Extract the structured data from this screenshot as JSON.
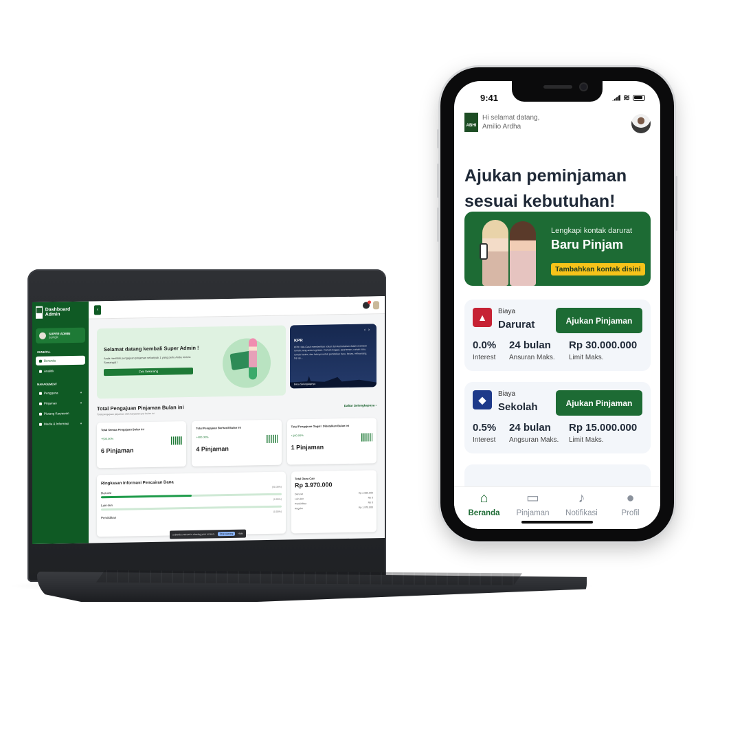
{
  "laptop": {
    "sidebar": {
      "brand_title": "Dashboard Admin",
      "user_name": "SUPER ADMIN",
      "user_role": "SUPER",
      "section_general": "GENERAL",
      "section_management": "MANAGEMENT",
      "items": [
        {
          "label": "Beranda",
          "icon": "home-icon",
          "active": true
        },
        {
          "label": "Analitik",
          "icon": "chart-icon",
          "active": false
        },
        {
          "label": "Pengguna",
          "icon": "user-icon",
          "active": false
        },
        {
          "label": "Pinjaman",
          "icon": "card-icon",
          "active": false
        },
        {
          "label": "Piutang Karyawan",
          "icon": "wallet-icon",
          "active": false
        },
        {
          "label": "Media & Informasi",
          "icon": "media-icon",
          "active": false
        }
      ]
    },
    "welcome": {
      "title": "Selamat datang kembali Super Admin !",
      "text": "Anda memiliki pengajuan pinjaman sebanyak 1 yang perlu Anda review. Semangat !",
      "button": "Cek Sekarang"
    },
    "kpr": {
      "title": "KPR",
      "text": "KPR Hulu-Cash memberikan solusi dan kemudahan dalam membeli rumah yang anda inginkan. Rumah tinggal, apartemen, rumah toko, rumah kantor, dan lainnya untuk pembelian baru, bekas, refinancing, top up...",
      "link": "Baca Selengkapnya"
    },
    "section": {
      "title": "Total Pengajuan Pinjaman Bulan ini",
      "subtitle": "Total pengajuan pinjaman oleh karyawan per bulan ini",
      "link": "Daftar Selengkapnya"
    },
    "stat_cards": [
      {
        "title": "Total Semua Pengajuan Bulan ini",
        "change": "+500.00%",
        "value": "6 Pinjaman"
      },
      {
        "title": "Total Pengajuan Berhasil Bulan ini",
        "change": "+400.00%",
        "value": "4 Pinjaman"
      },
      {
        "title": "Total Pengajuan Gagal / Dibatalkan Bulan ini",
        "change": "+100.00%",
        "value": "1 Pinjaman"
      }
    ],
    "summary": {
      "title": "Ringkasan Informasi Pencairan Dana",
      "rows": [
        {
          "label": "Darurat",
          "pct": "(50.38%)",
          "fill": 0.5038
        },
        {
          "label": "Lain-lain",
          "pct": "(0.00%)",
          "fill": 0
        },
        {
          "label": "Pendidikan",
          "pct": "(0.00%)",
          "fill": 0
        }
      ]
    },
    "total": {
      "title": "Total Dana Cair",
      "value": "Rp 3.970.000",
      "rows": [
        {
          "label": "Darurat",
          "value": "Rp 2.000.000"
        },
        {
          "label": "Lain-lain",
          "value": "Rp 0"
        },
        {
          "label": "Pendidikan",
          "value": "Rp 0"
        },
        {
          "label": "Reguler",
          "value": "Rp 1.970.000"
        }
      ]
    },
    "share_bar": {
      "text": "ucbweb.coetrust is sharing your screen.",
      "stop": "Stop sharing",
      "hide": "Hide"
    }
  },
  "phone": {
    "status_time": "9:41",
    "logo_text": "ABHI",
    "greeting_line1": "Hi selamat datang,",
    "greeting_line2": "Amilio Ardha",
    "title": "Ajukan peminjaman sesuai kebutuhan!",
    "banner": {
      "subtitle": "Lengkapi kontak darurat",
      "headline": "Baru Pinjam",
      "button": "Tambahkan kontak disini"
    },
    "cards": [
      {
        "caption": "Biaya",
        "name": "Darurat",
        "icon": "warning-icon",
        "color": "#c62234",
        "button": "Ajukan Pinjaman",
        "stats": [
          {
            "value": "0.0%",
            "label": "Interest"
          },
          {
            "value": "24 bulan",
            "label": "Ansuran Maks."
          },
          {
            "value": "Rp 30.000.000",
            "label": "Limit Maks."
          }
        ]
      },
      {
        "caption": "Biaya",
        "name": "Sekolah",
        "icon": "graduation-cap-icon",
        "color": "#1e3a8a",
        "button": "Ajukan Pinjaman",
        "stats": [
          {
            "value": "0.5%",
            "label": "Interest"
          },
          {
            "value": "24 bulan",
            "label": "Angsuran Maks."
          },
          {
            "value": "Rp 15.000.000",
            "label": "Limit Maks."
          }
        ]
      }
    ],
    "nav": [
      {
        "label": "Beranda",
        "icon": "home-icon",
        "active": true
      },
      {
        "label": "Pinjaman",
        "icon": "card-icon",
        "active": false
      },
      {
        "label": "Notifikasi",
        "icon": "bell-icon",
        "active": false
      },
      {
        "label": "Profil",
        "icon": "user-icon",
        "active": false
      }
    ],
    "brand_color": "#1d6b34"
  }
}
